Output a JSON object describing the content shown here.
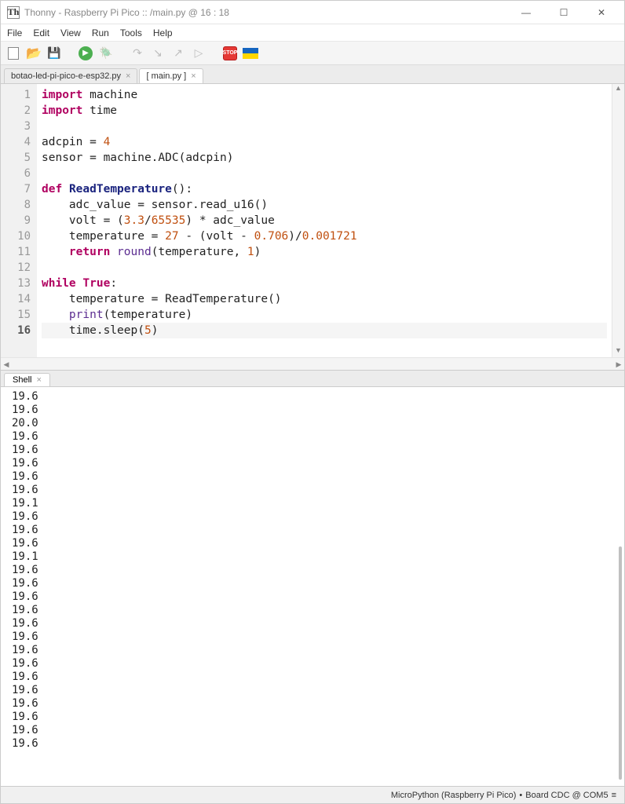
{
  "window": {
    "title": "Thonny  -  Raspberry Pi Pico :: /main.py  @  16 : 18",
    "app_icon_text": "Th"
  },
  "menu": {
    "items": [
      "File",
      "Edit",
      "View",
      "Run",
      "Tools",
      "Help"
    ]
  },
  "tabs": {
    "inactive": "botao-led-pi-pico-e-esp32.py",
    "active": "[ main.py ]",
    "close_glyph": "×"
  },
  "shell_tab": {
    "label": "Shell",
    "close_glyph": "×"
  },
  "gutter": [
    "1",
    "2",
    "3",
    "4",
    "5",
    "6",
    "7",
    "8",
    "9",
    "10",
    "11",
    "12",
    "13",
    "14",
    "15",
    "16"
  ],
  "code": {
    "l1_a": "import",
    "l1_b": " machine",
    "l2_a": "import",
    "l2_b": " time",
    "l3": "",
    "l4_a": "adcpin = ",
    "l4_b": "4",
    "l5": "sensor = machine.ADC(adcpin)",
    "l6": "",
    "l7_a": "def",
    "l7_b": " ",
    "l7_c": "ReadTemperature",
    "l7_d": "():",
    "l8": "    adc_value = sensor.read_u16()",
    "l9_a": "    volt = (",
    "l9_b": "3.3",
    "l9_c": "/",
    "l9_d": "65535",
    "l9_e": ") * adc_value",
    "l10_a": "    temperature = ",
    "l10_b": "27",
    "l10_c": " - (volt - ",
    "l10_d": "0.706",
    "l10_e": ")/",
    "l10_f": "0.001721",
    "l11_a": "    ",
    "l11_b": "return",
    "l11_c": " ",
    "l11_d": "round",
    "l11_e": "(temperature, ",
    "l11_f": "1",
    "l11_g": ")",
    "l12": "",
    "l13_a": "while",
    "l13_b": " ",
    "l13_c": "True",
    "l13_d": ":",
    "l14": "    temperature = ReadTemperature()",
    "l15_a": "    ",
    "l15_b": "print",
    "l15_c": "(temperature)",
    "l16_a": "    time.sleep(",
    "l16_b": "5",
    "l16_c": ")"
  },
  "shell_output": "19.6\n19.6\n20.0\n19.6\n19.6\n19.6\n19.6\n19.6\n19.1\n19.6\n19.6\n19.6\n19.1\n19.6\n19.6\n19.6\n19.6\n19.6\n19.6\n19.6\n19.6\n19.6\n19.6\n19.6\n19.6\n19.6\n19.6",
  "status": {
    "interpreter": "MicroPython (Raspberry Pi Pico)",
    "separator": "•",
    "port": "Board CDC @ COM5",
    "menu_glyph": "≡"
  },
  "toolbar": {
    "stop_text": "STOP",
    "run_glyph": "▶",
    "step_over": "↷",
    "step_into": "↘",
    "step_out": "↗",
    "resume": "▷"
  }
}
